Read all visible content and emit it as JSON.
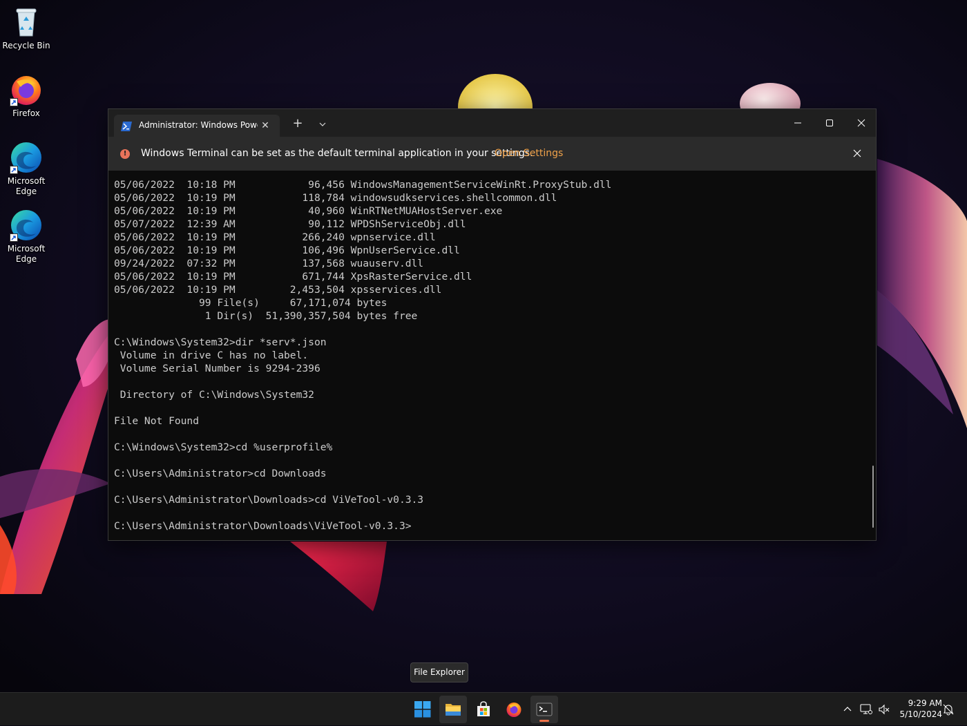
{
  "desktop": {
    "icons": [
      {
        "label": "Recycle Bin",
        "icon": "recycle-bin-icon"
      },
      {
        "label": "Firefox",
        "icon": "firefox-icon"
      },
      {
        "label": "Microsoft Edge",
        "icon": "edge-icon"
      },
      {
        "label": "Microsoft Edge",
        "icon": "edge-icon"
      }
    ]
  },
  "terminal": {
    "tab_title": "Administrator: Windows PowerShell",
    "tab_icon": "powershell-icon",
    "new_tab_glyph": "+",
    "close_glyph": "✕",
    "infobar": {
      "message": "Windows Terminal can be set as the default terminal application in your settings.",
      "link": "Open Settings",
      "icon_glyph": "!"
    },
    "lines": [
      "05/06/2022  10:18 PM            96,456 WindowsManagementServiceWinRt.ProxyStub.dll",
      "05/06/2022  10:19 PM           118,784 windowsudkservices.shellcommon.dll",
      "05/06/2022  10:19 PM            40,960 WinRTNetMUAHostServer.exe",
      "05/07/2022  12:39 AM            90,112 WPDShServiceObj.dll",
      "05/06/2022  10:19 PM           266,240 wpnservice.dll",
      "05/06/2022  10:19 PM           106,496 WpnUserService.dll",
      "09/24/2022  07:32 PM           137,568 wuauserv.dll",
      "05/06/2022  10:19 PM           671,744 XpsRasterService.dll",
      "05/06/2022  10:19 PM         2,453,504 xpsservices.dll",
      "              99 File(s)     67,171,074 bytes",
      "               1 Dir(s)  51,390,357,504 bytes free",
      "",
      "C:\\Windows\\System32>dir *serv*.json",
      " Volume in drive C has no label.",
      " Volume Serial Number is 9294-2396",
      "",
      " Directory of C:\\Windows\\System32",
      "",
      "File Not Found",
      "",
      "C:\\Windows\\System32>cd %userprofile%",
      "",
      "C:\\Users\\Administrator>cd Downloads",
      "",
      "C:\\Users\\Administrator\\Downloads>cd ViVeTool-v0.3.3",
      "",
      "C:\\Users\\Administrator\\Downloads\\ViVeTool-v0.3.3>"
    ]
  },
  "tooltip": "File Explorer",
  "taskbar": {
    "apps": [
      "start-icon",
      "file-explorer-icon",
      "microsoft-store-icon",
      "firefox-icon",
      "terminal-icon"
    ],
    "tray_icons": [
      "chevron-up-icon",
      "network-icon",
      "volume-muted-icon",
      "notification-icon"
    ],
    "time": "9:29 AM",
    "date": "5/10/2024"
  },
  "colors": {
    "accent": "#f0734a",
    "link": "#f0a24a",
    "console_text": "#cccccc",
    "console_bg": "#0c0c0c"
  }
}
